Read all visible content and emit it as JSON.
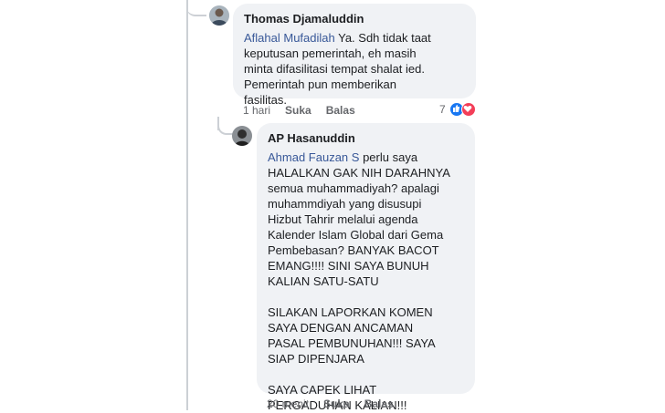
{
  "comments": [
    {
      "author": "Thomas Djamaluddin",
      "mention": "Aflahal Mufadilah",
      "text": " Ya. Sdh tidak taat\nkeputusan pemerintah, eh masih\nminta difasilitasi tempat shalat ied.\nPemerintah pun memberikan\nfasilitas.",
      "time": "1 hari",
      "like_label": "Suka",
      "reply_label": "Balas",
      "reaction_count": "7",
      "reaction_colors": [
        "#1877f2",
        "#f33e58"
      ]
    },
    {
      "author": "AP Hasanuddin",
      "mention": "Ahmad Fauzan S",
      "text": " perlu saya\nHALALKAN GAK NIH DARAHNYA\nsemua muhammadiyah? apalagi\nmuhammdiyah yang disusupi\nHizbut Tahrir melalui agenda\nKalender Islam Global dari Gema\nPembebasan? BANYAK BACOT\nEMANG!!!! SINI SAYA BUNUH\nKALIAN SATU-SATU\n\nSILAKAN LAPORKAN KOMEN\nSAYA DENGAN ANCAMAN\nPASAL PEMBUNUHAN!!! SAYA\nSIAP DIPENJARA\n\nSAYA CAPEK LIHAT\nPERGADUHAN KALIAN!!!",
      "time": "20 menit",
      "like_label": "Suka",
      "reply_label": "Balas"
    }
  ]
}
